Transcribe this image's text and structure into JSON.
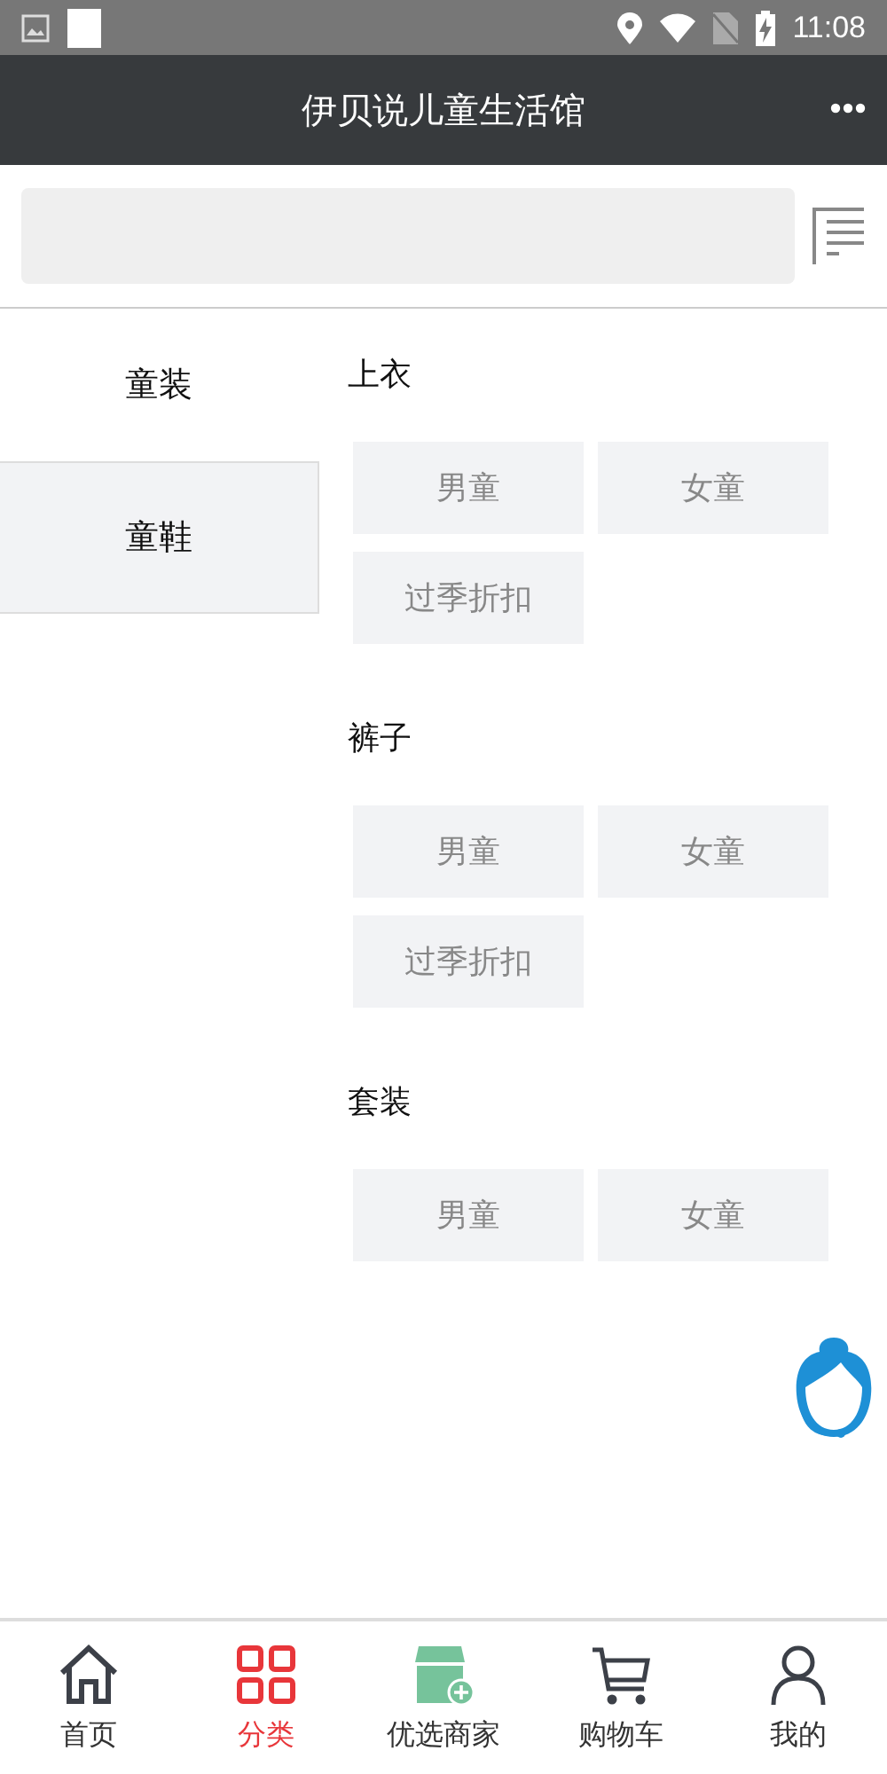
{
  "status_bar": {
    "time": "11:08"
  },
  "header": {
    "title": "伊贝说儿童生活馆"
  },
  "sidebar": {
    "items": [
      {
        "label": "童装",
        "selected": true
      },
      {
        "label": "童鞋",
        "selected": false
      }
    ]
  },
  "sections": [
    {
      "title": "上衣",
      "tags": [
        "男童",
        "女童",
        "过季折扣"
      ]
    },
    {
      "title": "裤子",
      "tags": [
        "男童",
        "女童",
        "过季折扣"
      ]
    },
    {
      "title": "套装",
      "tags": [
        "男童",
        "女童"
      ]
    }
  ],
  "bottom_nav": [
    {
      "label": "首页",
      "kind": "home",
      "selected": false
    },
    {
      "label": "分类",
      "kind": "grid",
      "selected": true
    },
    {
      "label": "优选商家",
      "kind": "shop",
      "selected": false
    },
    {
      "label": "购物车",
      "kind": "cart",
      "selected": false
    },
    {
      "label": "我的",
      "kind": "user",
      "selected": false
    }
  ]
}
